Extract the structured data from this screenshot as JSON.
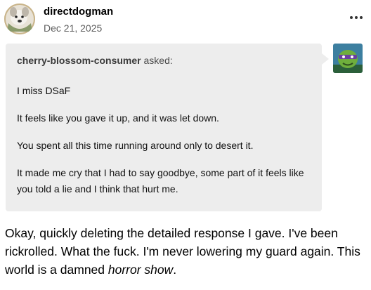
{
  "post": {
    "username": "directdogman",
    "date": "Dec 21, 2025",
    "more_icon": "ellipsis-icon"
  },
  "ask": {
    "asker": "cherry-blossom-consumer",
    "asked_label": "asked:",
    "paragraphs": [
      "I miss DSaF",
      "It feels like you gave it up, and it was let down.",
      "You spent all this time running around only to desert it.",
      "It made me cry that I had to say goodbye, some part of it feels like you told a lie and I think that hurt me."
    ]
  },
  "answer": {
    "text_main": "Okay, quickly deleting the detailed response I gave. I've been rickrolled. What the fuck. I'm never lowering my guard again. This world is a damned ",
    "text_emphasis": "horror show",
    "text_end": "."
  },
  "colors": {
    "ask_background": "#ededed",
    "date_text": "#5e5e5e"
  }
}
